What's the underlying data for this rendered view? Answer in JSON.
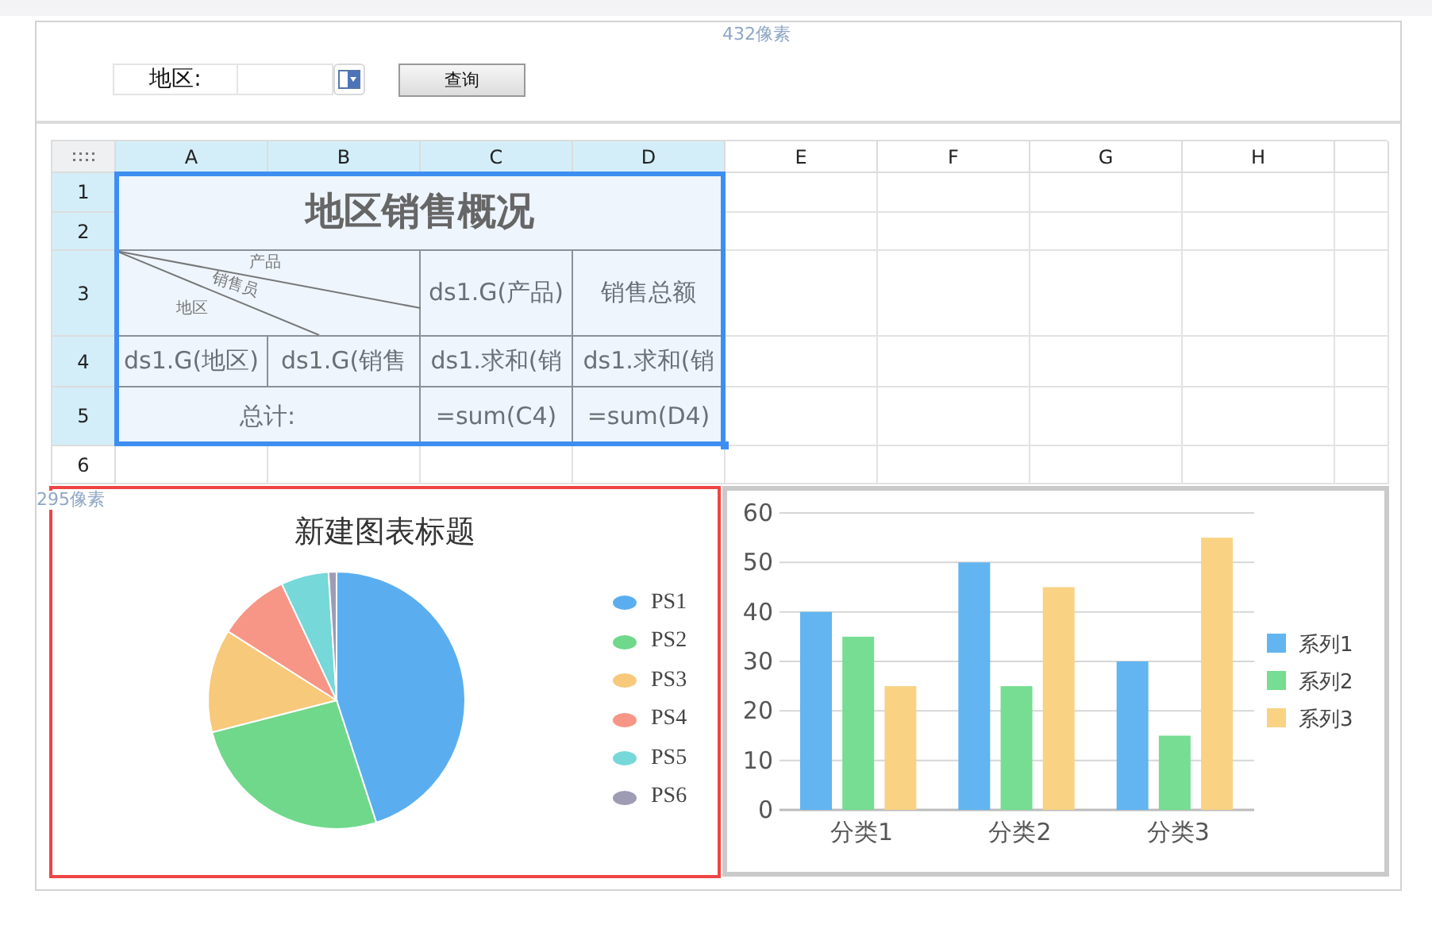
{
  "canvas_width_label": "432像素",
  "parameters": {
    "label": "地区:",
    "query_button": "查询"
  },
  "sheet": {
    "columns": [
      {
        "label": "A",
        "selected": true
      },
      {
        "label": "B",
        "selected": true
      },
      {
        "label": "C",
        "selected": true
      },
      {
        "label": "D",
        "selected": true
      },
      {
        "label": "E",
        "selected": false
      },
      {
        "label": "F",
        "selected": false
      },
      {
        "label": "G",
        "selected": false
      },
      {
        "label": "H",
        "selected": false
      }
    ],
    "rows": [
      {
        "label": "1",
        "selected": true
      },
      {
        "label": "2",
        "selected": true
      },
      {
        "label": "3",
        "selected": true
      },
      {
        "label": "4",
        "selected": true
      },
      {
        "label": "5",
        "selected": true
      },
      {
        "label": "6",
        "selected": false
      }
    ],
    "cells": [
      {
        "kind": "title",
        "text": "地区销售概况",
        "selected": true
      },
      {
        "kind": "diagonal",
        "labels": [
          "产品",
          "销售员",
          "地区"
        ],
        "selected": true
      },
      {
        "kind": "text",
        "text": "ds1.G(产品)",
        "selected": true
      },
      {
        "kind": "text",
        "text": "销售总额",
        "selected": true
      },
      {
        "kind": "text",
        "text": "ds1.G(地区)",
        "selected": true
      },
      {
        "kind": "text",
        "text": "ds1.G(销售",
        "selected": true
      },
      {
        "kind": "text",
        "text": "ds1.求和(销",
        "selected": true
      },
      {
        "kind": "text",
        "text": "ds1.求和(销",
        "selected": true
      },
      {
        "kind": "text",
        "text": "总计:",
        "selected": true
      },
      {
        "kind": "text",
        "text": "=sum(C4)",
        "selected": true
      },
      {
        "kind": "text",
        "text": "=sum(D4)",
        "selected": true
      }
    ]
  },
  "chart_height_label": "295像素",
  "pie_chart": {
    "title": "新建图表标题",
    "selected": true,
    "legend": [
      {
        "label": "PS1",
        "color": "#5aaef0"
      },
      {
        "label": "PS2",
        "color": "#6fd88b"
      },
      {
        "label": "PS3",
        "color": "#f7c97a"
      },
      {
        "label": "PS4",
        "color": "#f79586"
      },
      {
        "label": "PS5",
        "color": "#76d8d8"
      },
      {
        "label": "PS6",
        "color": "#9e9bb5"
      }
    ]
  },
  "bar_chart": {
    "chart_data": {
      "type": "bar",
      "categories": [
        "分类1",
        "分类2",
        "分类3"
      ],
      "series": [
        {
          "name": "系列1",
          "color": "#62b5f0",
          "values": [
            40,
            50,
            30
          ]
        },
        {
          "name": "系列2",
          "color": "#76dd92",
          "values": [
            35,
            25,
            15
          ]
        },
        {
          "name": "系列3",
          "color": "#f9d283",
          "values": [
            25,
            45,
            55
          ]
        }
      ],
      "ylim": [
        0,
        60
      ],
      "yticks": [
        0,
        10,
        20,
        30,
        40,
        50,
        60
      ],
      "grid": true,
      "legend": true
    }
  }
}
